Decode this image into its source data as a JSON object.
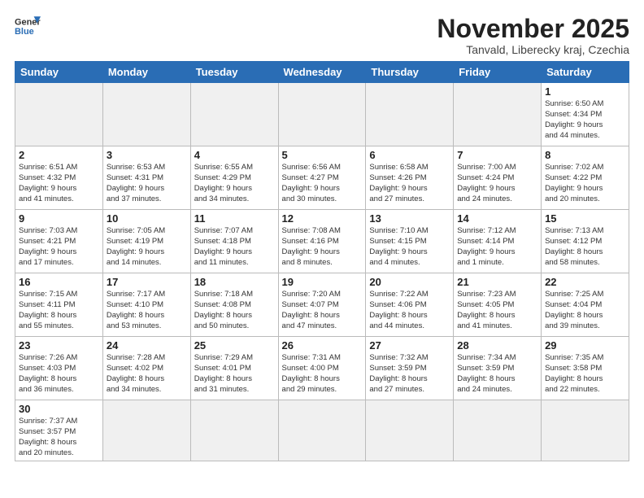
{
  "header": {
    "logo_general": "General",
    "logo_blue": "Blue",
    "month_title": "November 2025",
    "location": "Tanvald, Liberecky kraj, Czechia"
  },
  "weekdays": [
    "Sunday",
    "Monday",
    "Tuesday",
    "Wednesday",
    "Thursday",
    "Friday",
    "Saturday"
  ],
  "weeks": [
    [
      {
        "day": "",
        "info": ""
      },
      {
        "day": "",
        "info": ""
      },
      {
        "day": "",
        "info": ""
      },
      {
        "day": "",
        "info": ""
      },
      {
        "day": "",
        "info": ""
      },
      {
        "day": "",
        "info": ""
      },
      {
        "day": "1",
        "info": "Sunrise: 6:50 AM\nSunset: 4:34 PM\nDaylight: 9 hours\nand 44 minutes."
      }
    ],
    [
      {
        "day": "2",
        "info": "Sunrise: 6:51 AM\nSunset: 4:32 PM\nDaylight: 9 hours\nand 41 minutes."
      },
      {
        "day": "3",
        "info": "Sunrise: 6:53 AM\nSunset: 4:31 PM\nDaylight: 9 hours\nand 37 minutes."
      },
      {
        "day": "4",
        "info": "Sunrise: 6:55 AM\nSunset: 4:29 PM\nDaylight: 9 hours\nand 34 minutes."
      },
      {
        "day": "5",
        "info": "Sunrise: 6:56 AM\nSunset: 4:27 PM\nDaylight: 9 hours\nand 30 minutes."
      },
      {
        "day": "6",
        "info": "Sunrise: 6:58 AM\nSunset: 4:26 PM\nDaylight: 9 hours\nand 27 minutes."
      },
      {
        "day": "7",
        "info": "Sunrise: 7:00 AM\nSunset: 4:24 PM\nDaylight: 9 hours\nand 24 minutes."
      },
      {
        "day": "8",
        "info": "Sunrise: 7:02 AM\nSunset: 4:22 PM\nDaylight: 9 hours\nand 20 minutes."
      }
    ],
    [
      {
        "day": "9",
        "info": "Sunrise: 7:03 AM\nSunset: 4:21 PM\nDaylight: 9 hours\nand 17 minutes."
      },
      {
        "day": "10",
        "info": "Sunrise: 7:05 AM\nSunset: 4:19 PM\nDaylight: 9 hours\nand 14 minutes."
      },
      {
        "day": "11",
        "info": "Sunrise: 7:07 AM\nSunset: 4:18 PM\nDaylight: 9 hours\nand 11 minutes."
      },
      {
        "day": "12",
        "info": "Sunrise: 7:08 AM\nSunset: 4:16 PM\nDaylight: 9 hours\nand 8 minutes."
      },
      {
        "day": "13",
        "info": "Sunrise: 7:10 AM\nSunset: 4:15 PM\nDaylight: 9 hours\nand 4 minutes."
      },
      {
        "day": "14",
        "info": "Sunrise: 7:12 AM\nSunset: 4:14 PM\nDaylight: 9 hours\nand 1 minute."
      },
      {
        "day": "15",
        "info": "Sunrise: 7:13 AM\nSunset: 4:12 PM\nDaylight: 8 hours\nand 58 minutes."
      }
    ],
    [
      {
        "day": "16",
        "info": "Sunrise: 7:15 AM\nSunset: 4:11 PM\nDaylight: 8 hours\nand 55 minutes."
      },
      {
        "day": "17",
        "info": "Sunrise: 7:17 AM\nSunset: 4:10 PM\nDaylight: 8 hours\nand 53 minutes."
      },
      {
        "day": "18",
        "info": "Sunrise: 7:18 AM\nSunset: 4:08 PM\nDaylight: 8 hours\nand 50 minutes."
      },
      {
        "day": "19",
        "info": "Sunrise: 7:20 AM\nSunset: 4:07 PM\nDaylight: 8 hours\nand 47 minutes."
      },
      {
        "day": "20",
        "info": "Sunrise: 7:22 AM\nSunset: 4:06 PM\nDaylight: 8 hours\nand 44 minutes."
      },
      {
        "day": "21",
        "info": "Sunrise: 7:23 AM\nSunset: 4:05 PM\nDaylight: 8 hours\nand 41 minutes."
      },
      {
        "day": "22",
        "info": "Sunrise: 7:25 AM\nSunset: 4:04 PM\nDaylight: 8 hours\nand 39 minutes."
      }
    ],
    [
      {
        "day": "23",
        "info": "Sunrise: 7:26 AM\nSunset: 4:03 PM\nDaylight: 8 hours\nand 36 minutes."
      },
      {
        "day": "24",
        "info": "Sunrise: 7:28 AM\nSunset: 4:02 PM\nDaylight: 8 hours\nand 34 minutes."
      },
      {
        "day": "25",
        "info": "Sunrise: 7:29 AM\nSunset: 4:01 PM\nDaylight: 8 hours\nand 31 minutes."
      },
      {
        "day": "26",
        "info": "Sunrise: 7:31 AM\nSunset: 4:00 PM\nDaylight: 8 hours\nand 29 minutes."
      },
      {
        "day": "27",
        "info": "Sunrise: 7:32 AM\nSunset: 3:59 PM\nDaylight: 8 hours\nand 27 minutes."
      },
      {
        "day": "28",
        "info": "Sunrise: 7:34 AM\nSunset: 3:59 PM\nDaylight: 8 hours\nand 24 minutes."
      },
      {
        "day": "29",
        "info": "Sunrise: 7:35 AM\nSunset: 3:58 PM\nDaylight: 8 hours\nand 22 minutes."
      }
    ],
    [
      {
        "day": "30",
        "info": "Sunrise: 7:37 AM\nSunset: 3:57 PM\nDaylight: 8 hours\nand 20 minutes."
      },
      {
        "day": "",
        "info": ""
      },
      {
        "day": "",
        "info": ""
      },
      {
        "day": "",
        "info": ""
      },
      {
        "day": "",
        "info": ""
      },
      {
        "day": "",
        "info": ""
      },
      {
        "day": "",
        "info": ""
      }
    ]
  ]
}
